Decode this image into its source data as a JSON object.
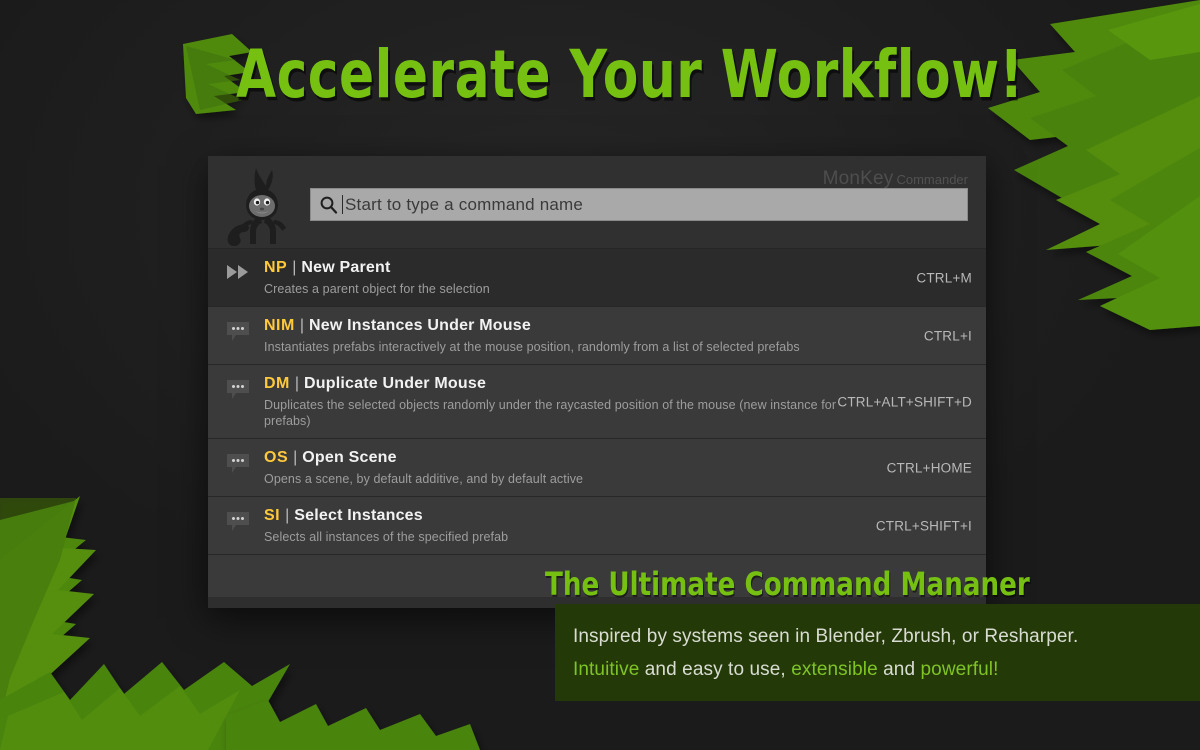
{
  "headline": "Accelerate Your Workflow!",
  "colors": {
    "accent_green": "#76c012",
    "highlight_green": "#7ec426",
    "abbr_yellow": "#ffc93c",
    "background": "#1b1b1b",
    "panel": "#3a3a3a",
    "panel_selected": "#2b2b2b",
    "caption_box": "#243908",
    "search_field": "#a9a9a9"
  },
  "window": {
    "brand_main": "MonKey",
    "brand_sub": "Commander",
    "mascot_icon": "monkey-mascot-icon",
    "search": {
      "icon": "search-icon",
      "placeholder": "Start to type a command name",
      "value": ""
    },
    "commands": [
      {
        "icon": "fast-forward-icon",
        "abbr": "NP",
        "separator": "|",
        "name": "New Parent",
        "description": "Creates a parent object for the selection",
        "shortcut": "CTRL+M",
        "selected": true
      },
      {
        "icon": "speech-bubble-icon",
        "abbr": "NIM",
        "separator": "|",
        "name": "New Instances Under Mouse",
        "description": "Instantiates prefabs interactively at the mouse position, randomly from a list of selected prefabs",
        "shortcut": "CTRL+I",
        "selected": false
      },
      {
        "icon": "speech-bubble-icon",
        "abbr": "DM",
        "separator": "|",
        "name": "Duplicate Under Mouse",
        "description": "Duplicates the selected objects randomly under the raycasted position of the mouse (new instance for prefabs)",
        "shortcut": "CTRL+ALT+SHIFT+D",
        "selected": false
      },
      {
        "icon": "speech-bubble-icon",
        "abbr": "OS",
        "separator": "|",
        "name": "Open Scene",
        "description": "Opens a scene, by default additive, and by default active",
        "shortcut": "CTRL+HOME",
        "selected": false
      },
      {
        "icon": "speech-bubble-icon",
        "abbr": "SI",
        "separator": "|",
        "name": "Select Instances",
        "description": "Selects all instances of the specified prefab",
        "shortcut": "CTRL+SHIFT+I",
        "selected": false
      }
    ]
  },
  "caption": {
    "title": "The Ultimate Command Mananer",
    "line1": "Inspired by systems seen in Blender, Zbrush, or Resharper.",
    "line2_part1": "Intuitive",
    "line2_part2": " and easy to use, ",
    "line2_part3": "extensible",
    "line2_part4": " and ",
    "line2_part5": "powerful!"
  }
}
